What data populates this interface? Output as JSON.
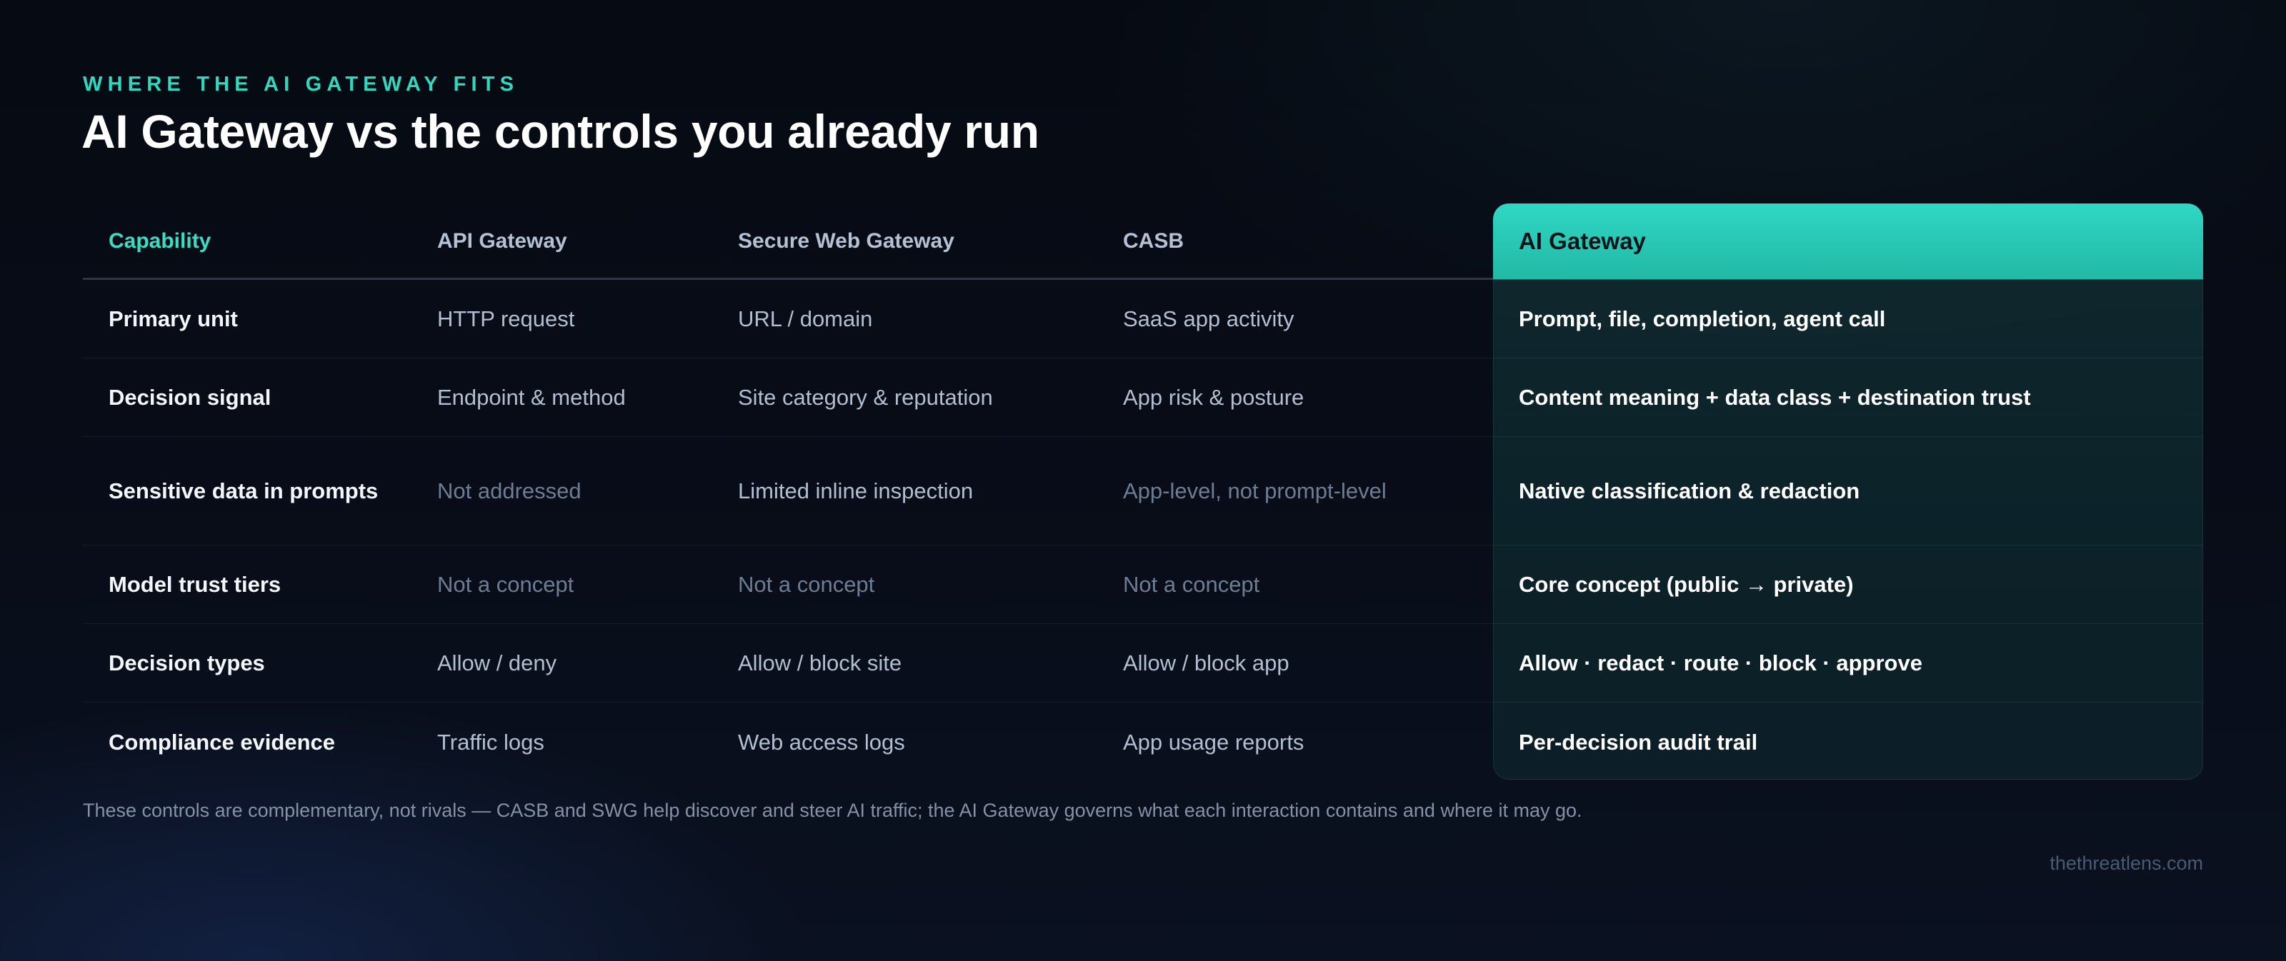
{
  "slide": {
    "eyebrow": "WHERE THE AI GATEWAY FITS",
    "title": "AI Gateway vs the controls you already run",
    "footnote": "These controls are complementary, not rivals — CASB and SWG help discover and steer AI traffic; the AI Gateway governs what each interaction contains and where it may go.",
    "brand": "thethreatlens.com"
  },
  "colors": {
    "accent": "#2fd8bf",
    "highlight_header": "#2fd8c4",
    "background": "#070b14"
  },
  "table": {
    "headers": [
      "Capability",
      "API Gateway",
      "Secure Web Gateway",
      "CASB",
      "AI Gateway"
    ],
    "highlighted_column": "AI Gateway",
    "rows": [
      {
        "capability": "Primary unit",
        "api_gateway": "HTTP request",
        "swg": "URL / domain",
        "casb": "SaaS app activity",
        "ai_gateway": "Prompt, file, completion, agent call"
      },
      {
        "capability": "Decision signal",
        "api_gateway": "Endpoint & method",
        "swg": "Site category & reputation",
        "casb": "App risk & posture",
        "ai_gateway": "Content meaning + data class + destination trust"
      },
      {
        "capability": "Sensitive data in prompts",
        "api_gateway": "Not addressed",
        "swg": "Limited inline inspection",
        "casb": "App-level, not prompt-level",
        "ai_gateway": "Native classification & redaction"
      },
      {
        "capability": "Model trust tiers",
        "api_gateway": "Not a concept",
        "swg": "Not a concept",
        "casb": "Not a concept",
        "ai_gateway": "Core concept (public → private)"
      },
      {
        "capability": "Decision types",
        "api_gateway": "Allow / deny",
        "swg": "Allow / block site",
        "casb": "Allow / block app",
        "ai_gateway": "Allow · redact · route · block · approve"
      },
      {
        "capability": "Compliance evidence",
        "api_gateway": "Traffic logs",
        "swg": "Web access logs",
        "casb": "App usage reports",
        "ai_gateway": "Per-decision audit trail"
      }
    ]
  }
}
